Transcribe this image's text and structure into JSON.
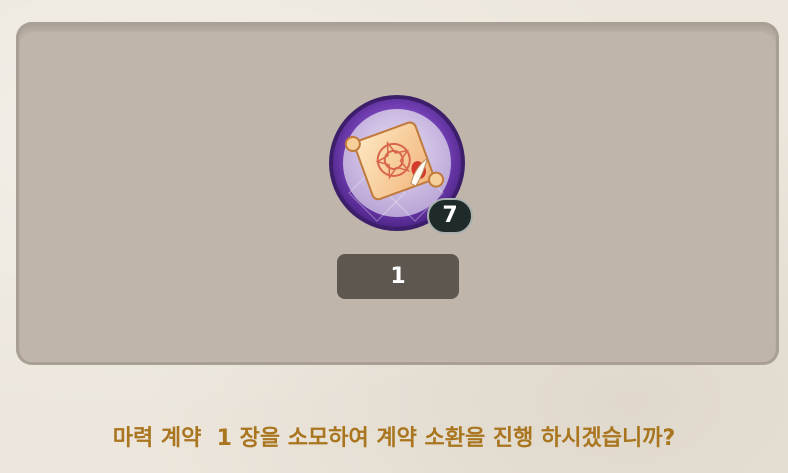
{
  "item": {
    "icon": "magic-contract-scroll-icon",
    "badge_count": "7"
  },
  "quantity": {
    "value": "1"
  },
  "message": {
    "text": "마력 계약  1 장을 소모하여 계약 소환을 진행 하시겠습니까?"
  },
  "colors": {
    "panel": "#c1b7ad",
    "quantity_bg": "#5d5750",
    "message_text": "#a9761f",
    "icon_ring": "#7c46bf"
  }
}
